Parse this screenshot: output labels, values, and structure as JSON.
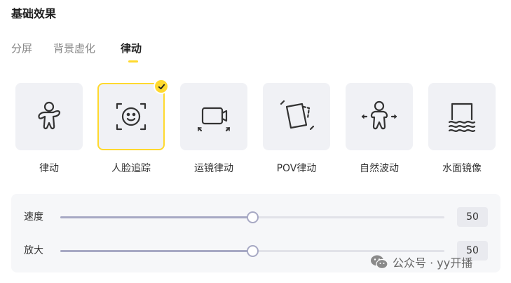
{
  "section_title": "基础效果",
  "tabs": [
    {
      "label": "分屏",
      "active": false
    },
    {
      "label": "背景虚化",
      "active": false
    },
    {
      "label": "律动",
      "active": true
    }
  ],
  "effects": [
    {
      "label": "律动",
      "icon": "person-dance-icon",
      "selected": false
    },
    {
      "label": "人脸追踪",
      "icon": "face-tracking-icon",
      "selected": true
    },
    {
      "label": "运镜律动",
      "icon": "camera-motion-icon",
      "selected": false
    },
    {
      "label": "POV律动",
      "icon": "pov-cards-icon",
      "selected": false
    },
    {
      "label": "自然波动",
      "icon": "person-wave-icon",
      "selected": false
    },
    {
      "label": "水面镜像",
      "icon": "water-mirror-icon",
      "selected": false
    }
  ],
  "sliders": [
    {
      "label": "速度",
      "value": "50",
      "level": 0.5
    },
    {
      "label": "放大",
      "value": "50",
      "level": 0.5
    }
  ],
  "watermark": {
    "text": "公众号 · yy开播",
    "icon": "wechat-icon"
  },
  "colors": {
    "accent": "#ffd92e",
    "track": "#a7a9c4",
    "tile": "#f0f1f5"
  }
}
